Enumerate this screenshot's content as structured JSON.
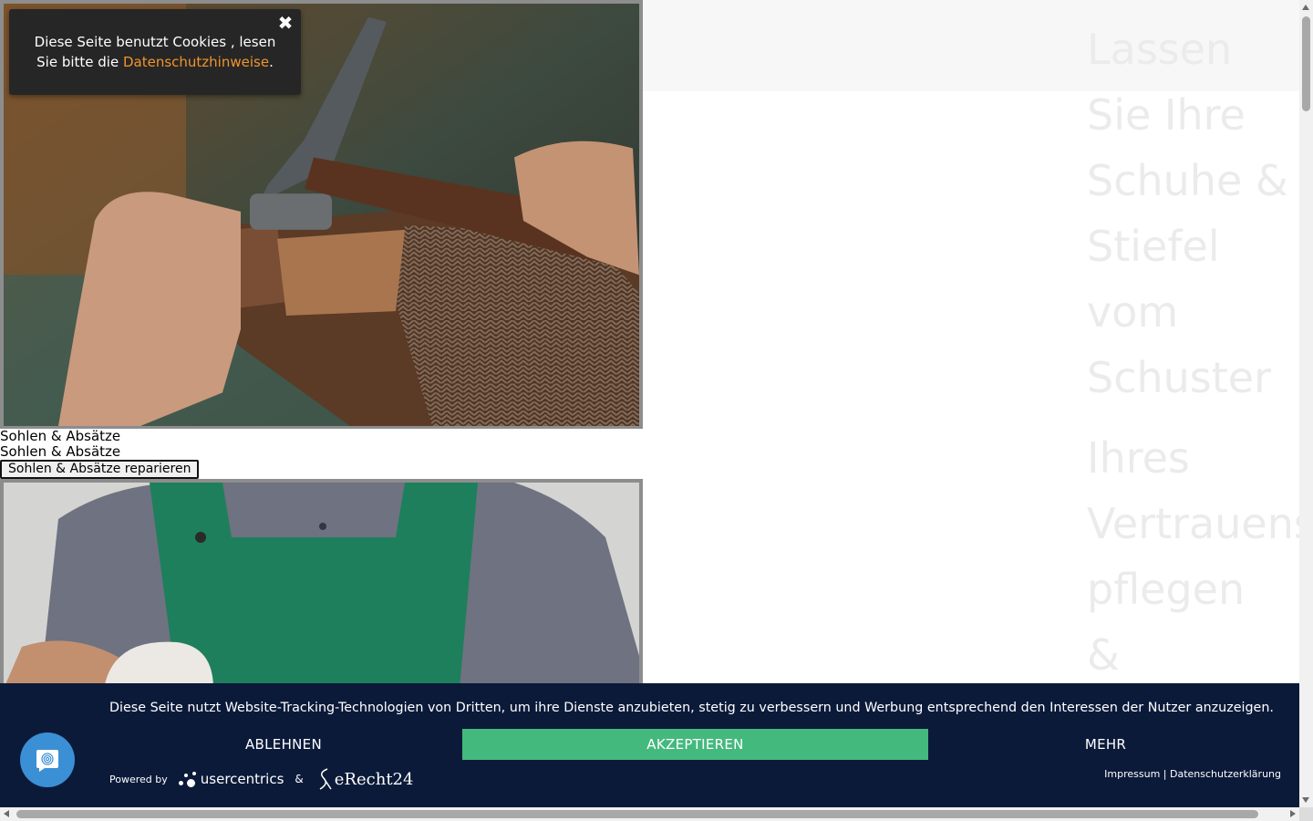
{
  "hero": {
    "heading_lines": [
      "Lassen",
      "Sie Ihre",
      "Schuhe &",
      "Stiefel",
      "vom",
      "Schuster"
    ],
    "sub_lines": [
      "Ihres",
      "Vertrauens",
      "pflegen",
      "&"
    ]
  },
  "cards": [
    {
      "image_alt": "Schuster repariert Sohle mit Hammer",
      "title": "Sohlen & Absätze",
      "subtitle": "Sohlen & Absätze",
      "button_label": "Sohlen & Absätze reparieren"
    },
    {
      "image_alt": "Schuster mit grüner Schürze"
    }
  ],
  "cookie_hint": {
    "text_before": "Diese Seite benutzt Cookies , lesen Sie bitte die ",
    "link_text": "Datenschutzhinweise",
    "text_after": ".",
    "close_glyph": "✖",
    "link_color": "#f0952d"
  },
  "consent": {
    "message": "Diese Seite nutzt Website-Tracking-Technologien von Dritten, um ihre Dienste anzubieten, stetig zu verbessern und Werbung entsprechend den Interessen der Nutzer anzuzeigen.",
    "decline_label": "ABLEHNEN",
    "accept_label": "AKZEPTIEREN",
    "more_label": "MEHR",
    "powered_by": "Powered by",
    "usercentrics_brand": "usercentrics",
    "ampersand": "&",
    "erecht_brand": "eRecht24",
    "impressum": "Impressum",
    "separator": "|",
    "privacy": "Datenschutzerklärung",
    "background_color": "#0c1a3a",
    "accept_color": "#44b97e"
  },
  "chat_button": {
    "icon": "fingerprint-chat-icon"
  }
}
